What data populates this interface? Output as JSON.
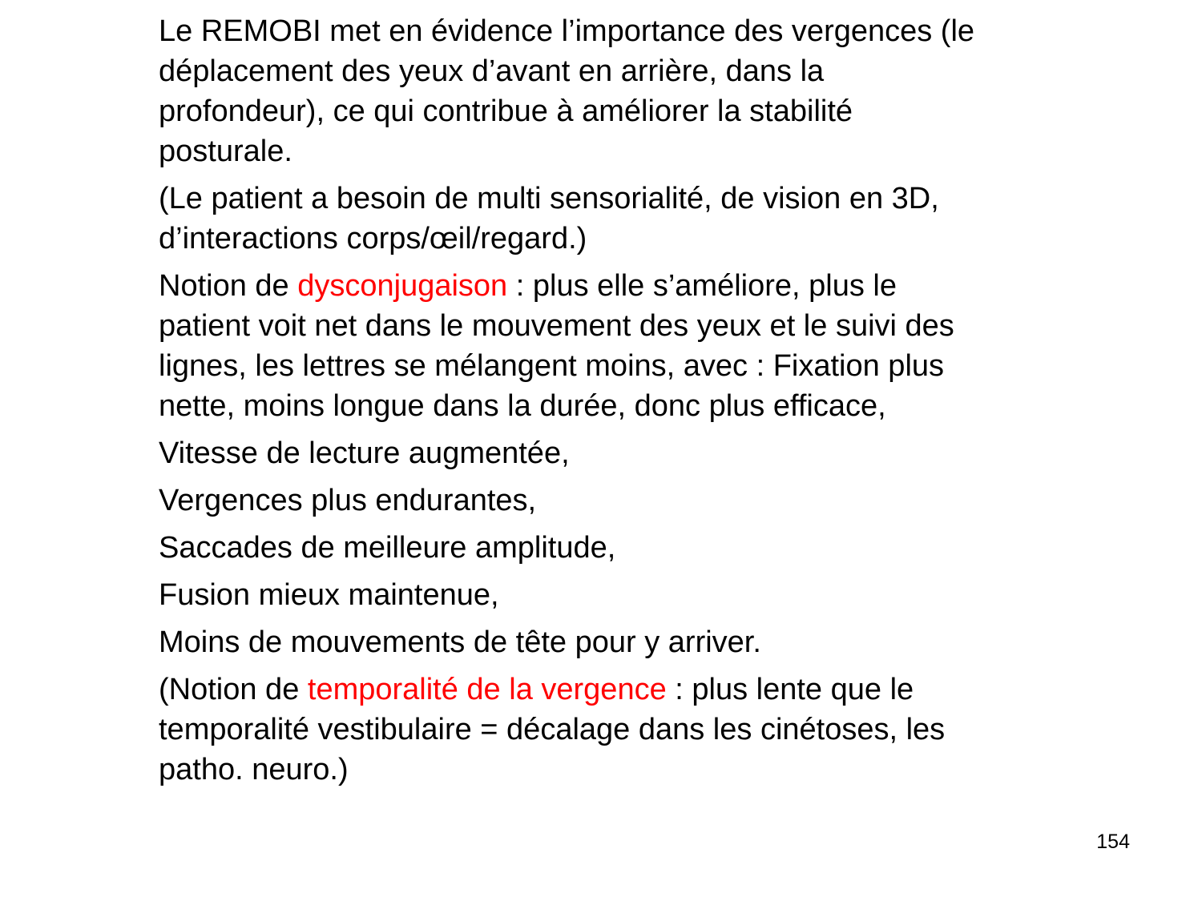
{
  "slide": {
    "paragraphs": [
      {
        "text": "Le REMOBI met en évidence l’importance des vergences (le déplacement des yeux d’avant en arrière, dans la profondeur), ce qui contribue à améliorer la stabilité posturale."
      },
      {
        "text": "(Le patient a besoin de multi sensorialité, de vision en 3D, d’interactions corps/œil/regard.)"
      },
      {
        "before": "Notion de ",
        "highlight": "dysconjugaison",
        "after": " : plus elle s’améliore, plus le patient voit net dans le mouvement des yeux et le suivi des lignes, les lettres se mélangent moins, avec : Fixation plus nette, moins longue dans la durée, donc plus efficace,"
      },
      {
        "text": "Vitesse de lecture augmentée,"
      },
      {
        "text": "Vergences plus endurantes,"
      },
      {
        "text": "Saccades de meilleure amplitude,"
      },
      {
        "text": "Fusion mieux maintenue,"
      },
      {
        "text": "Moins de mouvements de tête pour y arriver."
      },
      {
        "before": "(Notion de ",
        "highlight": "temporalité de la vergence",
        "after": " : plus lente que le temporalité vestibulaire = décalage dans les cinétoses, les patho. neuro.)"
      }
    ],
    "page_number": "154"
  },
  "colors": {
    "text": "#000000",
    "highlight": "#ff0000",
    "background": "#ffffff"
  }
}
